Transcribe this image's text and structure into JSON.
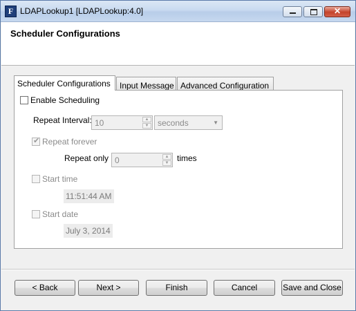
{
  "window": {
    "title": "LDAPLookup1 [LDAPLookup:4.0]",
    "icon": "F"
  },
  "header": {
    "title": "Scheduler Configurations"
  },
  "tabs": [
    {
      "label": "Scheduler Configurations",
      "active": true
    },
    {
      "label": "Input Message",
      "active": false
    },
    {
      "label": "Advanced Configuration",
      "active": false
    }
  ],
  "scheduler": {
    "enable_scheduling_label": "Enable Scheduling",
    "enable_scheduling_checked": false,
    "repeat_interval_label": "Repeat Interval:",
    "repeat_interval_value": "10",
    "repeat_interval_unit": "seconds",
    "repeat_forever_label": "Repeat forever",
    "repeat_forever_checked": true,
    "repeat_only_label": "Repeat only",
    "repeat_only_value": "0",
    "times_label": "times",
    "start_time_label": "Start time",
    "start_time_value": "11:51:44 AM",
    "start_date_label": "Start date",
    "start_date_value": "July 3, 2014"
  },
  "buttons": {
    "back": "< Back",
    "next": "Next >",
    "finish": "Finish",
    "cancel": "Cancel",
    "save_close": "Save and Close"
  }
}
